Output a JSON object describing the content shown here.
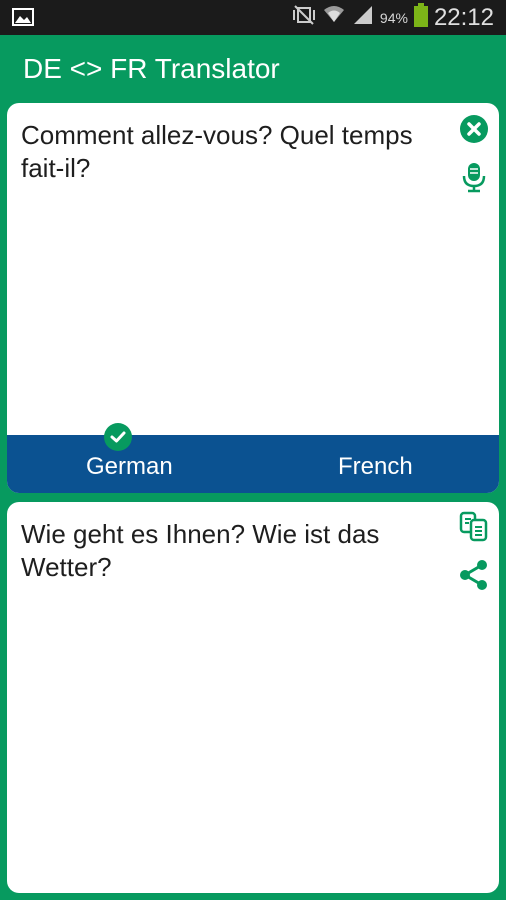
{
  "status_bar": {
    "time": "22:12",
    "battery_percent": "94%",
    "icons": [
      "gallery-notification-icon",
      "mute-vibrate-icon",
      "wifi-icon",
      "signal-icon",
      "battery-icon"
    ]
  },
  "app_bar": {
    "title": "DE <> FR Translator"
  },
  "source_card": {
    "text": "Comment allez-vous? Quel temps fait-il?",
    "icons": [
      "clear-icon",
      "microphone-icon"
    ]
  },
  "language_bar": {
    "left_label": "German",
    "right_label": "French",
    "selected": "German"
  },
  "result_card": {
    "text": "Wie geht es Ihnen? Wie ist das Wetter?",
    "icons": [
      "copy-icon",
      "share-icon"
    ]
  },
  "colors": {
    "primary": "#079a5f",
    "language_bar": "#0b5291",
    "status_bar": "#1b1b1b"
  }
}
